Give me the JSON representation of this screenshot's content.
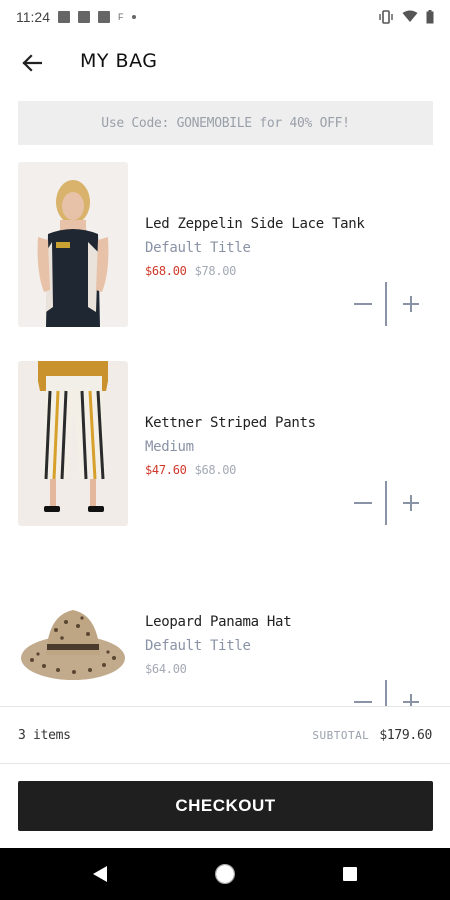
{
  "status": {
    "time": "11:24",
    "extra_small": "F"
  },
  "header": {
    "title": "MY BAG"
  },
  "promo": {
    "text": "Use Code: GONEMOBILE for 40% OFF!"
  },
  "items": [
    {
      "name": "Led Zeppelin Side Lace Tank",
      "variant": "Default Title",
      "sale_price": "$68.00",
      "original_price": "$78.00",
      "image": "woman-in-tank-top"
    },
    {
      "name": "Kettner Striped Pants",
      "variant": "Medium",
      "sale_price": "$47.60",
      "original_price": "$68.00",
      "image": "striped-pants"
    },
    {
      "name": "Leopard Panama Hat",
      "variant": "Default Title",
      "price": "$64.00",
      "image": "leopard-hat"
    }
  ],
  "summary": {
    "count": "3 items",
    "subtotal_label": "SUBTOTAL",
    "subtotal_value": "$179.60"
  },
  "checkout": {
    "label": "CHECKOUT"
  },
  "colors": {
    "sale": "#d0392b",
    "muted": "#8a93a6",
    "checkout_bg": "#1f1f1f"
  },
  "icons": {
    "back": "arrow-left-icon",
    "minus": "minus-icon",
    "plus": "plus-icon",
    "nav_back": "triangle-back-icon",
    "nav_home": "circle-home-icon",
    "nav_recents": "square-recents-icon"
  }
}
